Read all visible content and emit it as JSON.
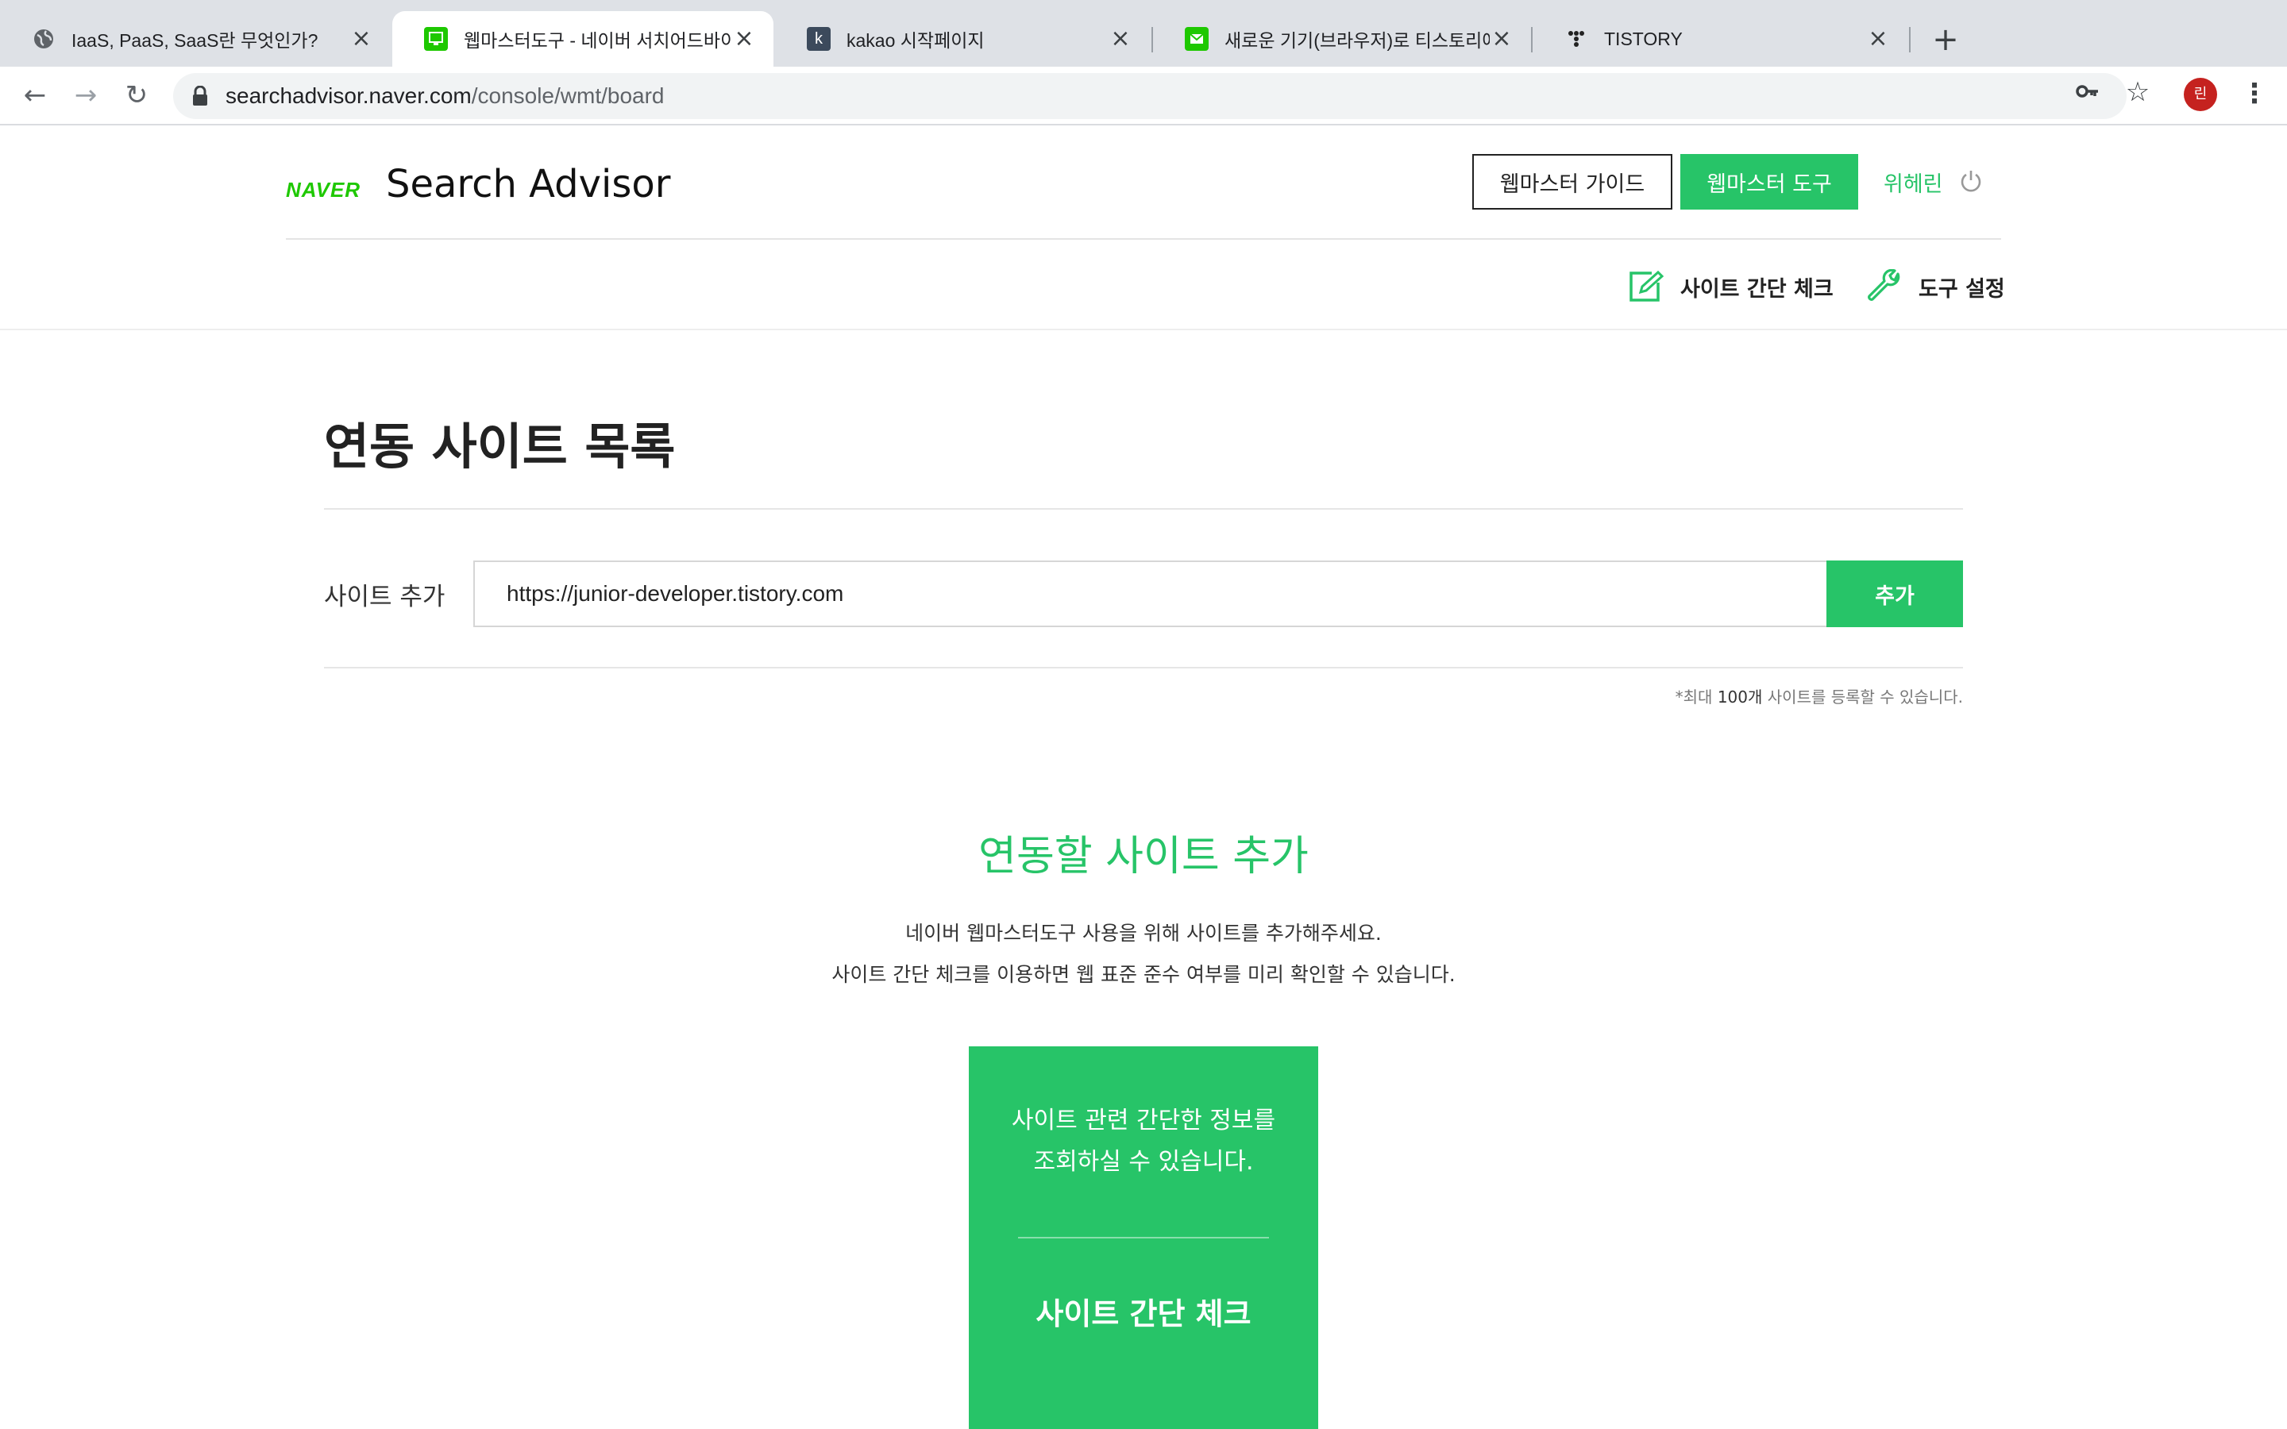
{
  "browser": {
    "tabs": [
      {
        "title": "IaaS, PaaS, SaaS란 무엇인가?",
        "icon": "globe-icon"
      },
      {
        "title": "웹마스터도구 - 네이버 서치어드바이저",
        "icon": "naver-webmaster-icon",
        "active": true
      },
      {
        "title": "kakao 시작페이지",
        "icon": "kakao-k-icon"
      },
      {
        "title": "새로운 기기(브라우저)로 티스토리에",
        "icon": "mail-icon"
      },
      {
        "title": "TISTORY",
        "icon": "tistory-icon"
      }
    ],
    "new_tab": "+",
    "url_host": "searchadvisor.naver.com",
    "url_path": "/console/wmt/board",
    "profile_initial": "린"
  },
  "header": {
    "logo": "NAVER",
    "brand": "Search Advisor",
    "guide_button": "웹마스터 가이드",
    "tool_button": "웹마스터 도구",
    "user_name": "위헤린",
    "sub_nav": {
      "site_check": "사이트 간단 체크",
      "tool_settings": "도구 설정"
    }
  },
  "main": {
    "title": "연동 사이트 목록",
    "add_label": "사이트 추가",
    "site_input_value": "https://junior-developer.tistory.com",
    "add_button": "추가",
    "limit_prefix": "*최대 ",
    "limit_count": "100개",
    "limit_suffix": " 사이트를 등록할 수 있습니다.",
    "section_title": "연동할 사이트 추가",
    "desc_line1": "네이버 웹마스터도구 사용을 위해 사이트를 추가해주세요.",
    "desc_line2": "사이트 간단 체크를 이용하면 웹 표준 준수 여부를 미리 확인할 수 있습니다.",
    "card": {
      "line1": "사이트 관련 간단한 정보를",
      "line2": "조회하실 수 있습니다.",
      "link": "사이트 간단 체크"
    }
  },
  "colors": {
    "accent_green": "#27c468",
    "naver_green": "#1ec800"
  }
}
